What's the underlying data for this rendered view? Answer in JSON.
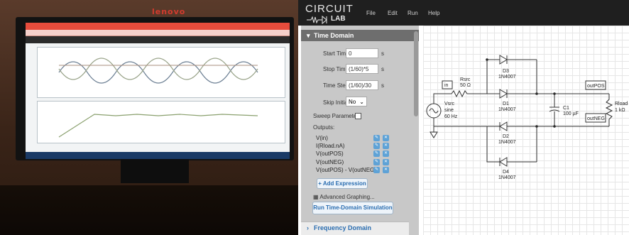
{
  "photo": {
    "brand": "lenovo"
  },
  "app": {
    "logo_top": "CIRCUIT",
    "logo_bottom": "LAB",
    "menu": [
      "File",
      "Edit",
      "Run",
      "Help"
    ]
  },
  "sim": {
    "section_title": "Time Domain",
    "start_time_label": "Start Time",
    "start_time_value": "0",
    "start_time_unit": "s",
    "stop_time_label": "Stop Time",
    "stop_time_value": "(1/60)*5",
    "stop_time_unit": "s",
    "time_step_label": "Time Step",
    "time_step_value": "(1/60)/30",
    "time_step_unit": "s",
    "skip_initial_label": "Skip Initial",
    "skip_initial_value": "No",
    "sweep_label": "Sweep Parameter:",
    "outputs_label": "Outputs:",
    "outputs": [
      "V(in)",
      "I(Rload.nA)",
      "V(outPOS)",
      "V(outNEG)",
      "V(outPOS) - V(outNEG)"
    ],
    "add_expression": "+ Add Expression",
    "advanced": "Advanced Graphing...",
    "run_button": "Run Time-Domain Simulation",
    "frequency_domain": "Frequency Domain"
  },
  "schematic": {
    "labels": {
      "in": "in",
      "rsrc_name": "Rsrc",
      "rsrc_value": "50 Ω",
      "vsrc_name": "Vsrc",
      "vsrc_type": "sine",
      "vsrc_freq": "60 Hz",
      "d3_name": "D3",
      "d3_part": "1N4007",
      "d1_name": "D1",
      "d1_part": "1N4007",
      "d2_name": "D2",
      "d2_part": "1N4007",
      "d4_name": "D4",
      "d4_part": "1N4007",
      "c1_name": "C1",
      "c1_value": "100 µF",
      "outpos": "outPOS",
      "outneg": "outNEG",
      "rload_name": "Rload",
      "rload_value": "1 kΩ"
    }
  }
}
